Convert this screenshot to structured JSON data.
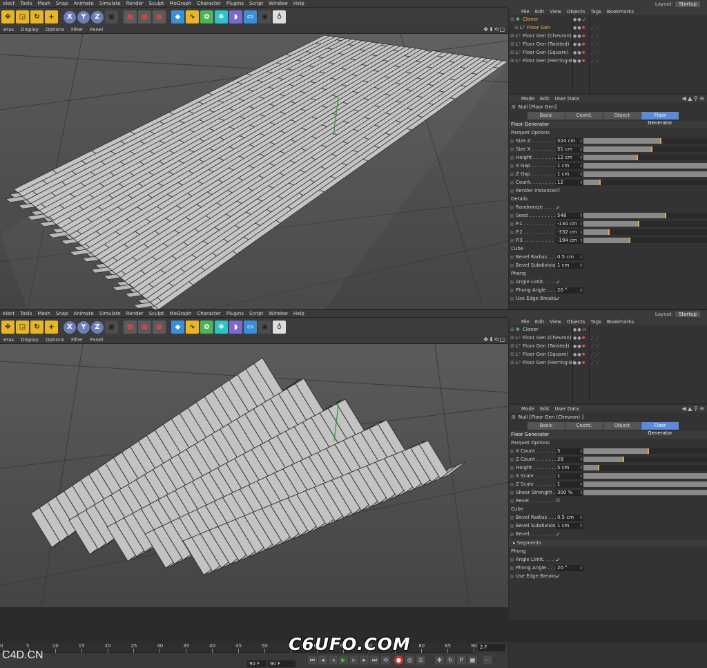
{
  "menu": [
    "elect",
    "Tools",
    "Mesh",
    "Snap",
    "Animate",
    "Simulate",
    "Render",
    "Sculpt",
    "MoGraph",
    "Character",
    "Plugins",
    "Script",
    "Window",
    "Help"
  ],
  "layout": {
    "label": "Layout:",
    "value": "Startup"
  },
  "viewport_menu": [
    "eras",
    "Display",
    "Options",
    "Filter",
    "Panel"
  ],
  "object_menu": [
    "File",
    "Edit",
    "View",
    "Objects",
    "Tags",
    "Bookmarks"
  ],
  "attr_menu": [
    "Mode",
    "Edit",
    "User Data"
  ],
  "tabs": [
    "Basic",
    "Coord.",
    "Object",
    "Floor Generator"
  ],
  "top": {
    "objects": [
      {
        "name": "Cloner",
        "selected": true,
        "status": "ok",
        "indent": 0
      },
      {
        "name": "Floor Gen",
        "selected": true,
        "status": "",
        "indent": 1
      },
      {
        "name": "Floor Gen (Chevron)",
        "selected": false,
        "status": "",
        "indent": 0
      },
      {
        "name": "Floor Gen (Twisted)",
        "selected": false,
        "status": "",
        "indent": 0
      },
      {
        "name": "Floor Gen (Square)",
        "selected": false,
        "status": "",
        "indent": 0
      },
      {
        "name": "Floor Gen (Herring-B)",
        "selected": false,
        "status": "",
        "indent": 0
      }
    ],
    "attr_title": "Null [Floor Gen]",
    "section": "Floor Generator",
    "groups": [
      {
        "name": "Parquet Options",
        "rows": [
          {
            "label": "Size Z . . . . . . . . .",
            "value": "524 cm",
            "fill": 0.63
          },
          {
            "label": "Size X . . . . . . . . .",
            "value": "51 cm",
            "fill": 0.56
          },
          {
            "label": "Height . . . . . . . .",
            "value": "12 cm",
            "fill": 0.44
          },
          {
            "label": "X Gap . . . . . . . . .",
            "value": "1 cm",
            "fill": 1.0
          },
          {
            "label": "Z Gap . . . . . . . . .",
            "value": "1 cm",
            "fill": 1.0
          },
          {
            "label": "Count. . . . . . . . .",
            "value": "12",
            "fill": 0.14
          },
          {
            "label": "Render Instances",
            "check": "box"
          }
        ]
      },
      {
        "name": "Details",
        "rows": [
          {
            "label": "Randomize . . . . .",
            "check": "✓"
          },
          {
            "label": "Seed . . . . . . . . .",
            "value": "548",
            "fill": 0.67
          },
          {
            "label": "P.1 . . . . . . . . . .",
            "value": "-134 cm",
            "fill": 0.45
          },
          {
            "label": "P.2 . . . . . . . . . .",
            "value": "-332 cm",
            "fill": 0.21
          },
          {
            "label": "P.3 . . . . . . . . . .",
            "value": "-194 cm",
            "fill": 0.38
          }
        ]
      },
      {
        "name": "Cube",
        "rows": [
          {
            "label": "Bevel Radius . . . .",
            "value": "0.5 cm"
          },
          {
            "label": "Bevel Subdivision",
            "value": "1 cm"
          }
        ]
      },
      {
        "name": "Phong",
        "rows": [
          {
            "label": "Angle Limit. . . . .",
            "check": "✓"
          },
          {
            "label": "Phong Angle . . . .",
            "value": "20 °"
          },
          {
            "label": "Use Edge Breaks",
            "check": "✓"
          }
        ]
      }
    ]
  },
  "bottom": {
    "objects": [
      {
        "name": "Cloner",
        "selected": false,
        "status": "no",
        "indent": 0
      },
      {
        "name": "Floor Gen (Chevron)",
        "selected": false,
        "status": "",
        "indent": 0
      },
      {
        "name": "Floor Gen (Twisted)",
        "selected": false,
        "status": "",
        "indent": 0
      },
      {
        "name": "Floor Gen (Square)",
        "selected": false,
        "status": "",
        "indent": 0
      },
      {
        "name": "Floor Gen (Herring-B)",
        "selected": false,
        "status": "",
        "indent": 0
      }
    ],
    "attr_title": "Null [Floor Gen (Chevron) ]",
    "section": "Floor Generator",
    "groups": [
      {
        "name": "Parquet Options",
        "rows": [
          {
            "label": "X Count . . . . . . .",
            "value": "5",
            "fill": 0.53
          },
          {
            "label": "Z Count . . . . . . .",
            "value": "29",
            "fill": 0.33
          },
          {
            "label": "Height . . . . . . . .",
            "value": "5 cm",
            "fill": 0.13
          },
          {
            "label": "X Scale . . . . . . . .",
            "value": "1",
            "fill": 1.0
          },
          {
            "label": "Z Scale . . . . . . . .",
            "value": "1",
            "fill": 1.0
          },
          {
            "label": "Shear Strength . .",
            "value": "300 %",
            "fill": 1.0
          },
          {
            "label": "Reset . . . . . . . . .",
            "check": "box"
          }
        ]
      },
      {
        "name": "Cube",
        "rows": [
          {
            "label": "Bevel Radius . . . .",
            "value": "0.5 cm"
          },
          {
            "label": "Bevel Subdivision",
            "value": "1 cm"
          },
          {
            "label": "Bevel. . . . . . . . .",
            "check": "✓"
          }
        ]
      },
      {
        "name": "_collapse",
        "label": "Segments"
      },
      {
        "name": "Phong",
        "rows": [
          {
            "label": "Angle Limit. . . . .",
            "check": "✓"
          },
          {
            "label": "Phong Angle . . . .",
            "value": "20 °"
          },
          {
            "label": "Use Edge Breaks",
            "check": "✓"
          }
        ]
      }
    ]
  },
  "timeline": {
    "ticks": [
      "0",
      "5",
      "10",
      "15",
      "20",
      "25",
      "30",
      "35",
      "40",
      "45",
      "50",
      "55",
      "60",
      "65",
      "70",
      "75",
      "80",
      "85",
      "90"
    ],
    "current_frame": "2 F",
    "end_a": "90 F",
    "end_b": "90 F"
  },
  "watermark": "C6UFO.COM",
  "watermark2": "C4D.CN"
}
